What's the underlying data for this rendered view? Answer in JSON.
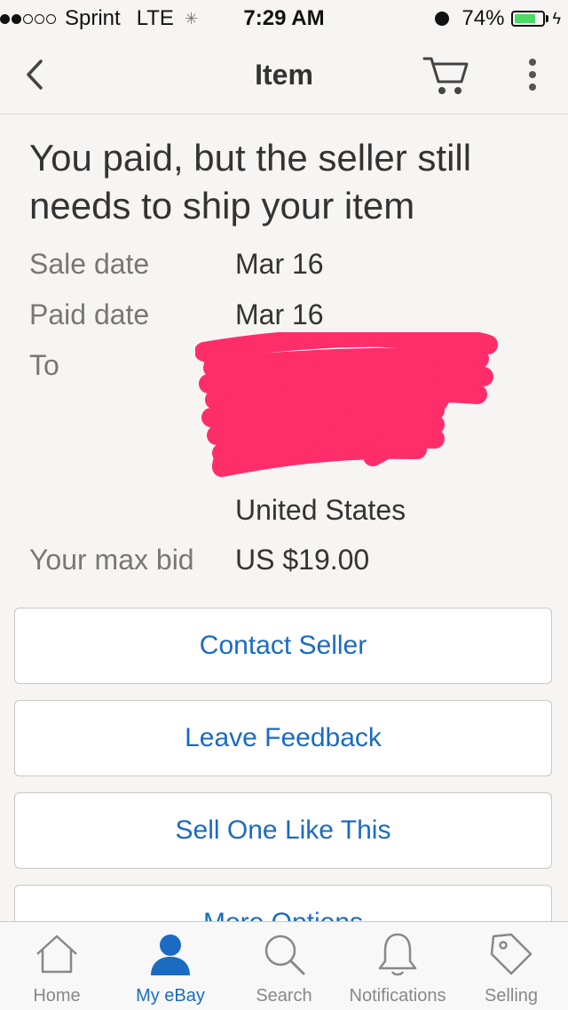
{
  "status_bar": {
    "carrier": "Sprint",
    "network": "LTE",
    "time": "7:29 AM",
    "battery_percent": "74%",
    "battery_level": 0.74,
    "signal_bars_filled": 2,
    "signal_bars_total": 5
  },
  "nav": {
    "title": "Item",
    "back_icon": "chevron-left-icon",
    "cart_icon": "cart-icon",
    "more_icon": "more-vertical-icon"
  },
  "headline": "You paid, but the seller still needs to ship your item",
  "details": {
    "sale_date_label": "Sale date",
    "sale_date_value": "Mar 16",
    "paid_date_label": "Paid date",
    "paid_date_value": "Mar 16",
    "to_label": "To",
    "address_visible_line": "United States",
    "max_bid_label": "Your max bid",
    "max_bid_value": "US $19.00"
  },
  "actions": {
    "contact_seller": "Contact Seller",
    "leave_feedback": "Leave Feedback",
    "sell_one_like_this": "Sell One Like This",
    "more_options": "More Options"
  },
  "tabs": [
    {
      "label": "Home",
      "icon": "home-icon",
      "active": false
    },
    {
      "label": "My eBay",
      "icon": "person-icon",
      "active": true
    },
    {
      "label": "Search",
      "icon": "search-icon",
      "active": false
    },
    {
      "label": "Notifications",
      "icon": "bell-icon",
      "active": false
    },
    {
      "label": "Selling",
      "icon": "tag-icon",
      "active": false
    }
  ],
  "colors": {
    "accent": "#1a6bc1",
    "background": "#f6f5f3",
    "redaction": "#ff2d6a",
    "battery": "#4cd964"
  }
}
